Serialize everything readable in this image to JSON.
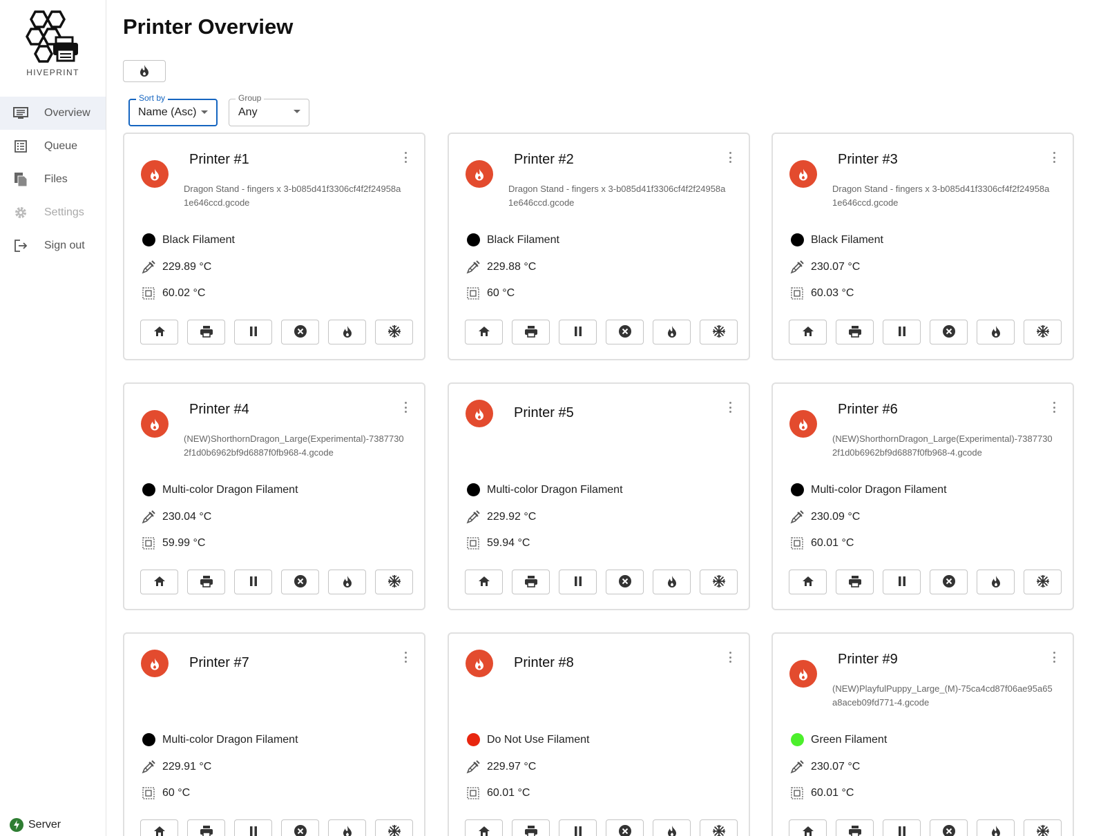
{
  "app": {
    "name": "HIVEPRINT"
  },
  "page": {
    "title": "Printer Overview"
  },
  "sidebar": {
    "items": [
      {
        "label": "Overview",
        "icon": "monitor-icon",
        "active": true
      },
      {
        "label": "Queue",
        "icon": "queue-list-icon"
      },
      {
        "label": "Files",
        "icon": "files-icon"
      },
      {
        "label": "Settings",
        "icon": "gear-icon",
        "disabled": true
      },
      {
        "label": "Sign out",
        "icon": "sign-out-icon"
      }
    ],
    "server_label": "Server"
  },
  "filters": {
    "sort_label": "Sort by",
    "sort_value": "Name (Asc)",
    "group_label": "Group",
    "group_value": "Any"
  },
  "colors": {
    "status_heating": "#e34b2e",
    "accent": "#1565c0",
    "server_ok": "#2e7d32"
  },
  "printers": [
    {
      "name": "Printer #1",
      "file": "Dragon Stand - fingers x 3-b085d41f3306cf4f2f24958a1e646ccd.gcode",
      "filament": "Black Filament",
      "filament_color": "#000000",
      "hotend": "229.89 °C",
      "bed": "60.02 °C"
    },
    {
      "name": "Printer #2",
      "file": "Dragon Stand - fingers x 3-b085d41f3306cf4f2f24958a1e646ccd.gcode",
      "filament": "Black Filament",
      "filament_color": "#000000",
      "hotend": "229.88 °C",
      "bed": "60 °C"
    },
    {
      "name": "Printer #3",
      "file": "Dragon Stand - fingers x 3-b085d41f3306cf4f2f24958a1e646ccd.gcode",
      "filament": "Black Filament",
      "filament_color": "#000000",
      "hotend": "230.07 °C",
      "bed": "60.03 °C"
    },
    {
      "name": "Printer #4",
      "file": "(NEW)ShorthornDragon_Large(Experimental)-73877302f1d0b6962bf9d6887f0fb968-4.gcode",
      "filament": "Multi-color Dragon Filament",
      "filament_color": "#000000",
      "hotend": "230.04 °C",
      "bed": "59.99 °C"
    },
    {
      "name": "Printer #5",
      "file": "",
      "filament": "Multi-color Dragon Filament",
      "filament_color": "#000000",
      "hotend": "229.92 °C",
      "bed": "59.94 °C"
    },
    {
      "name": "Printer #6",
      "file": "(NEW)ShorthornDragon_Large(Experimental)-73877302f1d0b6962bf9d6887f0fb968-4.gcode",
      "filament": "Multi-color Dragon Filament",
      "filament_color": "#000000",
      "hotend": "230.09 °C",
      "bed": "60.01 °C"
    },
    {
      "name": "Printer #7",
      "file": "",
      "filament": "Multi-color Dragon Filament",
      "filament_color": "#000000",
      "hotend": "229.91 °C",
      "bed": "60 °C"
    },
    {
      "name": "Printer #8",
      "file": "",
      "filament": "Do Not Use Filament",
      "filament_color": "#e8260f",
      "hotend": "229.97 °C",
      "bed": "60.01 °C"
    },
    {
      "name": "Printer #9",
      "file": "(NEW)PlayfulPuppy_Large_(M)-75ca4cd87f06ae95a65a8aceb09fd771-4.gcode",
      "filament": "Green Filament",
      "filament_color": "#4cef2c",
      "hotend": "230.07 °C",
      "bed": "60.01 °C"
    }
  ],
  "card_actions": [
    "home-icon",
    "print-icon",
    "pause-icon",
    "cancel-icon",
    "heat-icon",
    "cooldown-icon"
  ]
}
